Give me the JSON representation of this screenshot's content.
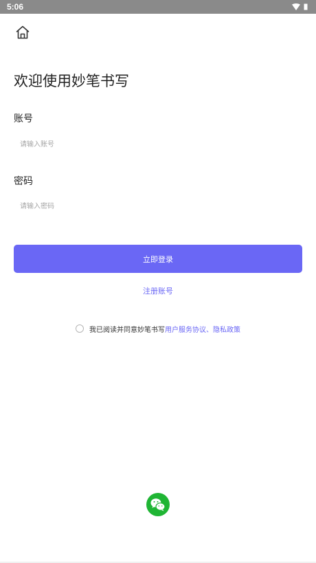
{
  "status_bar": {
    "time": "5:06",
    "icons": [
      "wifi-icon",
      "battery-icon"
    ]
  },
  "header": {
    "home_icon": "home-icon"
  },
  "title": "欢迎使用妙笔书写",
  "account": {
    "label": "账号",
    "placeholder": "请输入账号",
    "value": ""
  },
  "password": {
    "label": "密码",
    "placeholder": "请输入密码",
    "value": ""
  },
  "login_button": "立即登录",
  "register_link": "注册账号",
  "agreement": {
    "prefix": "我已阅读并同意妙笔书写",
    "user_agreement": "用户服务协议",
    "separator": "、",
    "privacy_policy": "隐私政策",
    "checked": false
  },
  "social_login": {
    "icon": "wechat-icon"
  },
  "colors": {
    "accent": "#6a67f5",
    "wechat": "#1fb534",
    "status_bar": "#8a8a8a"
  }
}
